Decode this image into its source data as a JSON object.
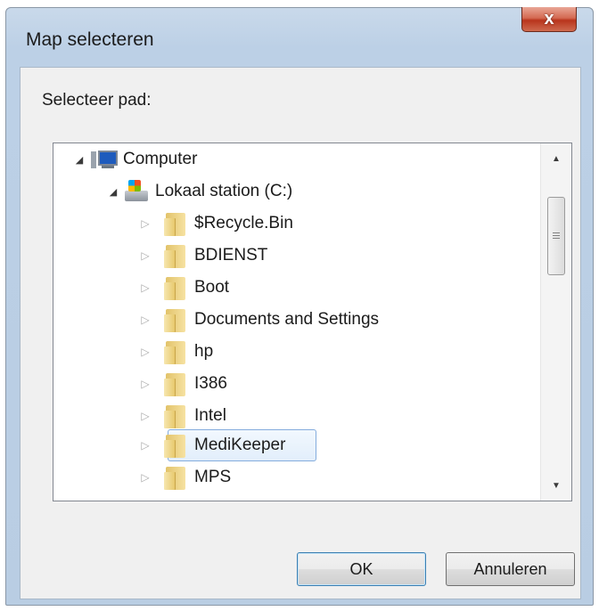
{
  "window": {
    "title": "Map selecteren",
    "close_label": "x"
  },
  "dialog": {
    "prompt": "Selecteer pad:"
  },
  "tree": {
    "root": {
      "label": "Computer",
      "icon": "computer-icon",
      "expanded": true
    },
    "drive": {
      "label": "Lokaal station (C:)",
      "icon": "drive-icon",
      "expanded": true
    },
    "folders": [
      {
        "label": "$Recycle.Bin"
      },
      {
        "label": "BDIENST"
      },
      {
        "label": "Boot"
      },
      {
        "label": "Documents and Settings"
      },
      {
        "label": "hp"
      },
      {
        "label": "I386"
      },
      {
        "label": "Intel"
      },
      {
        "label": "MediKeeper"
      },
      {
        "label": "MPS"
      }
    ],
    "selected": "MediKeeper"
  },
  "buttons": {
    "ok_label": "OK",
    "cancel_label": "Annuleren"
  },
  "colors": {
    "selection_border": "#84acdd",
    "close_button": "#c94a32",
    "default_button_border": "#3c7fb1"
  }
}
